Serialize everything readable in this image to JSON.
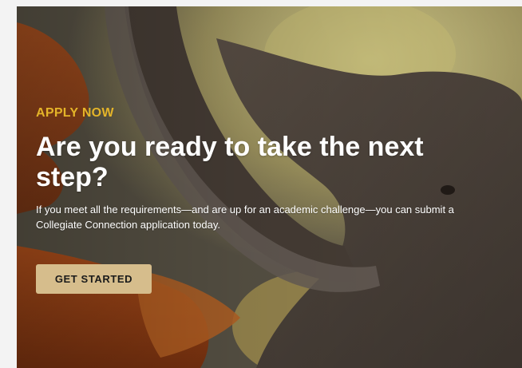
{
  "hero": {
    "eyebrow": "APPLY NOW",
    "headline": "Are you ready to take the next step?",
    "body": "If you meet all the requirements—and are up for an academic challenge—you can submit a Collegiate Connection application today.",
    "cta_label": "GET STARTED"
  },
  "colors": {
    "eyebrow": "#e4b429",
    "cta_background": "#d6bd8c",
    "text": "#ffffff"
  }
}
